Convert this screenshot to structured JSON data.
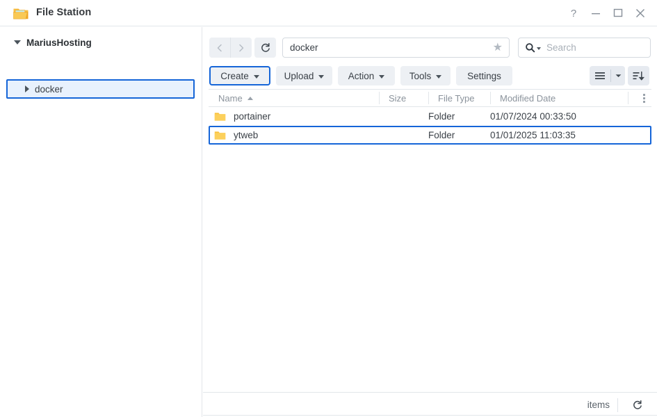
{
  "window": {
    "title": "File Station",
    "app_icon": "folder-icon",
    "controls": {
      "help": "help-icon",
      "minimize": "minimize-icon",
      "maximize": "maximize-icon",
      "close": "close-icon"
    }
  },
  "sidebar": {
    "root": {
      "label": "MariusHosting",
      "expanded": true
    },
    "items": [
      {
        "label": "docker",
        "expanded": false,
        "selected": true
      }
    ]
  },
  "nav": {
    "back_icon": "chevron-left-icon",
    "forward_icon": "chevron-right-icon",
    "refresh_icon": "refresh-icon",
    "path_value": "docker",
    "path_placeholder": "Path",
    "bookmark_icon": "star-icon",
    "search_placeholder": "Search",
    "search_icon": "search-icon"
  },
  "toolbar": {
    "create_label": "Create",
    "upload_label": "Upload",
    "action_label": "Action",
    "tools_label": "Tools",
    "settings_label": "Settings",
    "view_icon": "list-view-icon",
    "view_caret_icon": "chevron-down-icon",
    "sort_icon": "sort-descending-icon"
  },
  "table": {
    "columns": [
      {
        "key": "name",
        "label": "Name",
        "sorted": "asc"
      },
      {
        "key": "size",
        "label": "Size"
      },
      {
        "key": "type",
        "label": "File Type"
      },
      {
        "key": "date",
        "label": "Modified Date"
      }
    ],
    "more_icon": "kebab-menu-icon",
    "rows": [
      {
        "name": "portainer",
        "size": "",
        "type": "Folder",
        "date": "01/07/2024 00:33:50",
        "icon": "folder-icon",
        "selected": false
      },
      {
        "name": "ytweb",
        "size": "",
        "type": "Folder",
        "date": "01/01/2025 11:03:35",
        "icon": "folder-icon",
        "selected": true
      }
    ]
  },
  "status": {
    "items_label": "items",
    "refresh_icon": "refresh-icon"
  },
  "colors": {
    "accent": "#1565d8",
    "selection_bg": "#e8f1fd",
    "folder": "#f5b731",
    "button_bg": "#edf0f4",
    "border": "#e2e6ea"
  }
}
